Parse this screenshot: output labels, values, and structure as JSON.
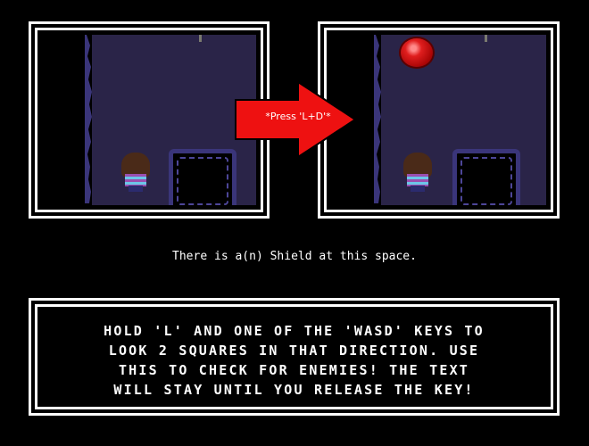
{
  "tutorial": {
    "arrow_label": "*Press  'L+D'*",
    "status_message": "There is a(n) Shield at this space.",
    "instruction_lines": "HOLD 'L' AND ONE OF THE 'WASD' KEYS TO\nLOOK 2 SQUARES IN THAT DIRECTION. USE\nTHIS TO CHECK FOR ENEMIES! THE TEXT\nWILL STAY UNTIL YOU RELEASE THE KEY!"
  },
  "scenes": {
    "before": {
      "item_visible": false
    },
    "after": {
      "item_visible": true,
      "item_name": "Shield"
    }
  },
  "colors": {
    "background": "#000000",
    "floor": "#2a2448",
    "pit_rim": "#3a357a",
    "arrow": "#ee1111",
    "orb": "#e01e1e",
    "text": "#ffffff"
  },
  "icons": {
    "arrow": "red-right-arrow-icon",
    "item": "red-orb-icon",
    "player": "player-character-icon"
  }
}
